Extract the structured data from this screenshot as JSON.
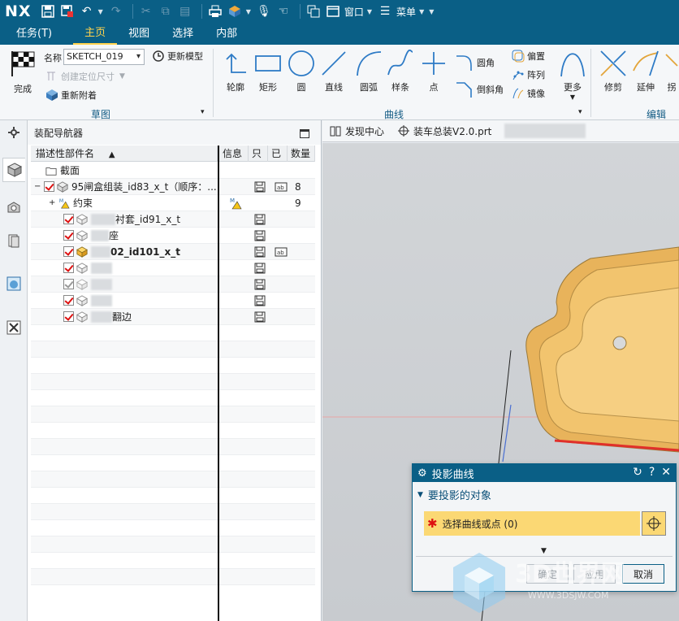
{
  "titlebar": {
    "logo": "NX",
    "window_label": "窗口",
    "menu_label": "菜单"
  },
  "tabs": [
    "任务(T)",
    "主页",
    "视图",
    "选择",
    "内部"
  ],
  "ribbon": {
    "finish_label": "完成",
    "name_label": "名称",
    "name_value": "SKETCH_019",
    "update_model": "更新模型",
    "create_dim": "创建定位尺寸",
    "reattach": "重新附着",
    "group_sketch": "草图",
    "curves": [
      {
        "label": "轮廓"
      },
      {
        "label": "矩形"
      },
      {
        "label": "圆"
      },
      {
        "label": "直线"
      },
      {
        "label": "圆弧"
      },
      {
        "label": "样条"
      },
      {
        "label": "点"
      }
    ],
    "fillet": "圆角",
    "chamfer": "倒斜角",
    "offset": "偏置",
    "pattern": "阵列",
    "mirror": "镜像",
    "more": "更多",
    "group_curve": "曲线",
    "trim": "修剪",
    "extend": "延伸",
    "edit_partial": "拐",
    "group_edit": "编辑"
  },
  "navigator": {
    "title": "装配导航器",
    "columns": {
      "name": "描述性部件名",
      "info": "信息",
      "readonly": "只",
      "loaded": "已",
      "qty": "数量"
    },
    "rows": [
      {
        "name": "截面",
        "type": "folder",
        "qty": ""
      },
      {
        "name": "95闸盒组装_id83_x_t（顺序：...",
        "type": "assembly",
        "qty": "8"
      },
      {
        "name": "约束",
        "type": "constraint",
        "qty": "9"
      },
      {
        "name_suffix": "衬套_id91_x_t",
        "type": "part",
        "qty": ""
      },
      {
        "name_suffix": "座",
        "type": "part",
        "qty": ""
      },
      {
        "name_suffix": "02_id101_x_t",
        "type": "part-active",
        "qty": ""
      },
      {
        "name_suffix": "",
        "type": "part",
        "qty": ""
      },
      {
        "name_suffix": "",
        "type": "part-grey",
        "qty": ""
      },
      {
        "name_suffix": "",
        "type": "part",
        "qty": ""
      },
      {
        "name_suffix": "翻边",
        "type": "part",
        "qty": ""
      }
    ]
  },
  "file_tabs": [
    {
      "label": "发现中心"
    },
    {
      "label": "装车总装V2.0.prt"
    }
  ],
  "dialog": {
    "title": "投影曲线",
    "section": "要投影的对象",
    "select_label": "选择曲线或点 (0)",
    "ok": "确定",
    "apply": "应用",
    "cancel": "取消"
  },
  "colors": {
    "brand": "#0a5f86",
    "active_tab": "#ffd34d",
    "selection_yellow": "#fbd874",
    "part_orange": "#f2c46e"
  }
}
